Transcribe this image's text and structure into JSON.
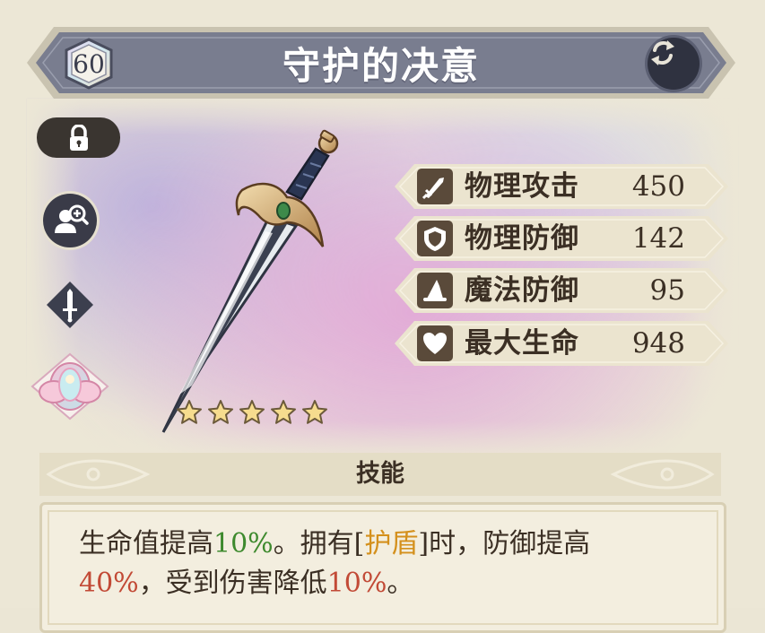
{
  "header": {
    "level": "60",
    "title": "守护的决意"
  },
  "stats": [
    {
      "label": "物理攻击",
      "value": "450",
      "icon": "sword-icon"
    },
    {
      "label": "物理防御",
      "value": "142",
      "icon": "shield-icon"
    },
    {
      "label": "魔法防御",
      "value": "95",
      "icon": "wizard-hat-icon"
    },
    {
      "label": "最大生命",
      "value": "948",
      "icon": "heart-icon"
    }
  ],
  "rarity": {
    "stars": 5
  },
  "skill": {
    "title": "技能",
    "parts": [
      "生命值提高",
      "10%",
      "。拥有[",
      "护盾",
      "]时，防御提高",
      "40%",
      "，受到伤害降低",
      "10%",
      "。"
    ]
  },
  "colors": {
    "banner": "#7a7e90",
    "highlight_green": "#3e8a2e",
    "highlight_red": "#c24a36",
    "highlight_gold": "#d4901c"
  }
}
